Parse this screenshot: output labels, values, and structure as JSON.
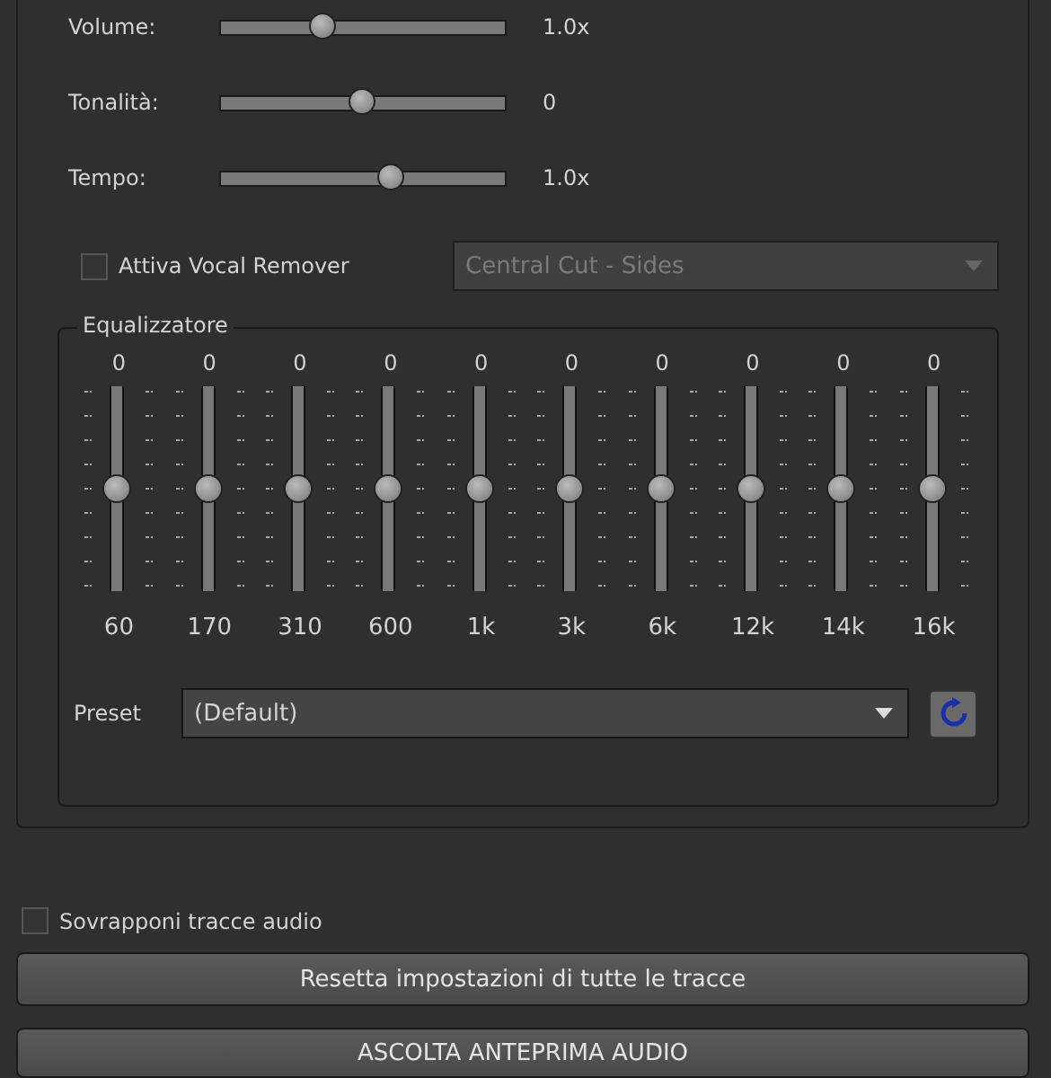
{
  "sliders": [
    {
      "label": "Volume:",
      "level": 0.36,
      "reading": "1.0x"
    },
    {
      "label": "Tonalità:",
      "level": 0.5,
      "reading": "0"
    },
    {
      "label": "Tempo:",
      "level": 0.6,
      "reading": "1.0x"
    }
  ],
  "vocal_remover": {
    "label": "Attiva Vocal Remover",
    "checked": false,
    "mode": {
      "value": "Central Cut - Sides",
      "disabled": true
    }
  },
  "equalizer": {
    "title": "Equalizzatore",
    "bands": [
      {
        "value": "0",
        "level": 0.5,
        "frequency": "60"
      },
      {
        "value": "0",
        "level": 0.5,
        "frequency": "170"
      },
      {
        "value": "0",
        "level": 0.5,
        "frequency": "310"
      },
      {
        "value": "0",
        "level": 0.5,
        "frequency": "600"
      },
      {
        "value": "0",
        "level": 0.5,
        "frequency": "1k"
      },
      {
        "value": "0",
        "level": 0.5,
        "frequency": "3k"
      },
      {
        "value": "0",
        "level": 0.5,
        "frequency": "6k"
      },
      {
        "value": "0",
        "level": 0.5,
        "frequency": "12k"
      },
      {
        "value": "0",
        "level": 0.5,
        "frequency": "14k"
      },
      {
        "value": "0",
        "level": 0.5,
        "frequency": "16k"
      }
    ],
    "preset": {
      "label": "Preset",
      "value": "(Default)"
    }
  },
  "overlap": {
    "label": "Sovrapponi tracce audio",
    "checked": false
  },
  "buttons": [
    "Resetta impostazioni di tutte le tracce",
    "ASCOLTA ANTEPRIMA AUDIO"
  ]
}
